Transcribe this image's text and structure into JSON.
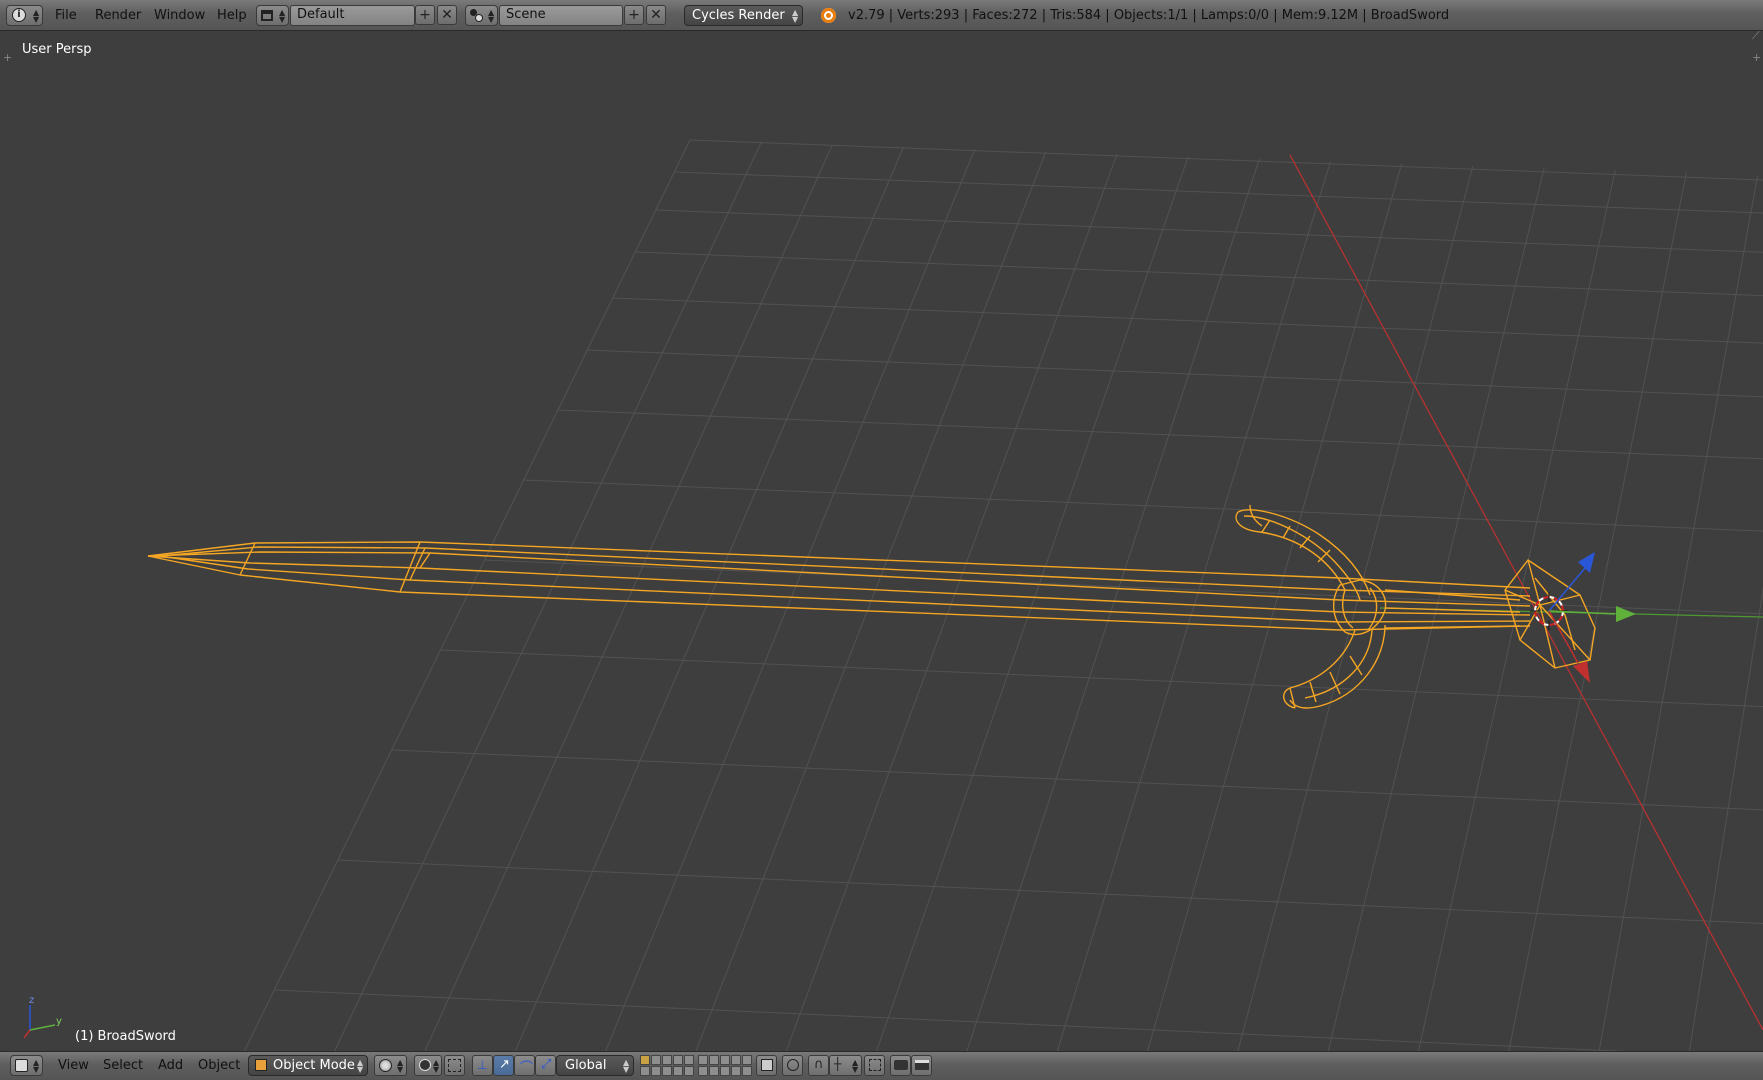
{
  "top_header": {
    "menus": [
      "File",
      "Render",
      "Window",
      "Help"
    ],
    "layout_name": "Default",
    "scene_name": "Scene",
    "render_engine": "Cycles Render",
    "stats": "v2.79 | Verts:293 | Faces:272 | Tris:584 | Objects:1/1 | Lamps:0/0 | Mem:9.12M | BroadSword"
  },
  "viewport": {
    "view_label": "User Persp",
    "object_label": "(1) BroadSword",
    "axis_labels": {
      "z": "z",
      "y": "y"
    },
    "colors": {
      "background": "#3d3d3d",
      "grid": "#4f4f4f",
      "wire_selected": "#f5a623",
      "x_axis": "#c0302e",
      "y_axis": "#5fb13c",
      "z_axis": "#2a56d8"
    }
  },
  "bottom_header": {
    "menus": [
      "View",
      "Select",
      "Add",
      "Object"
    ],
    "mode": "Object Mode",
    "transform_orientation": "Global"
  }
}
